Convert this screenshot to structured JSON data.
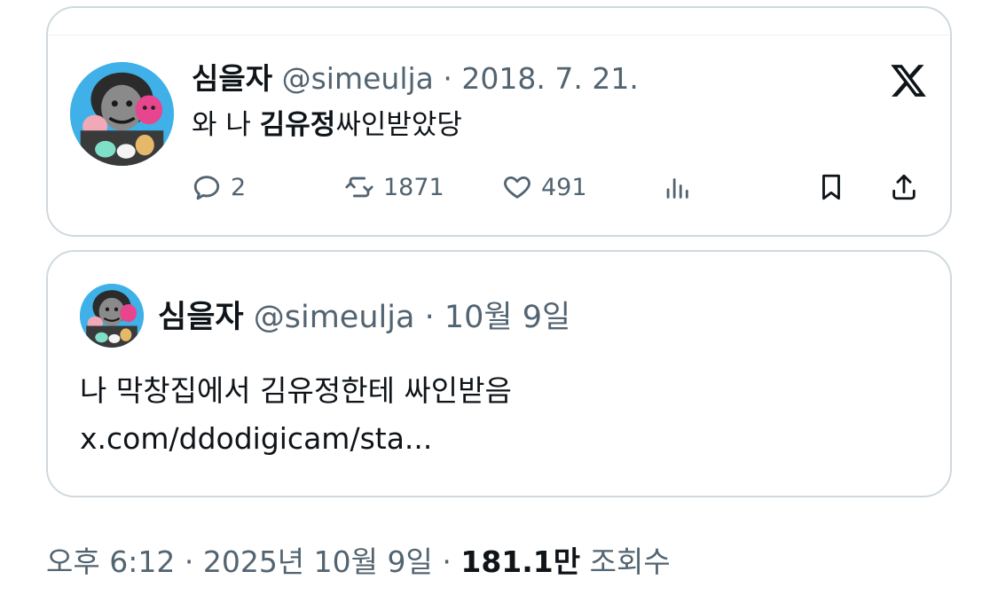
{
  "embed": {
    "author_name": "심을자",
    "handle": "@simeulja",
    "separator": "·",
    "date": "2018. 7. 21.",
    "text_prefix": "와 나 ",
    "text_bold": "김유정",
    "text_suffix": "싸인받았당",
    "actions": {
      "reply_count": "2",
      "retweet_count": "1871",
      "like_count": "491"
    }
  },
  "quote": {
    "author_name": "심을자",
    "handle": "@simeulja",
    "separator": "·",
    "date": "10월 9일",
    "text_line1": "나 막창집에서 김유정한테 싸인받음",
    "text_line2": "x.com/ddodigicam/sta..."
  },
  "footer": {
    "time": "오후 6:12",
    "separator1": "·",
    "date": "2025년 10월 9일",
    "separator2": "·",
    "views_count": "181.1만",
    "views_label": "조회수"
  },
  "icons": {
    "reply": "reply-icon",
    "retweet": "retweet-icon",
    "like": "heart-icon",
    "views": "analytics-icon",
    "bookmark": "bookmark-icon",
    "share": "share-icon",
    "brand": "x-logo-icon"
  },
  "colors": {
    "text_primary": "#0f1419",
    "text_secondary": "#536471",
    "border": "#cfd9de"
  }
}
